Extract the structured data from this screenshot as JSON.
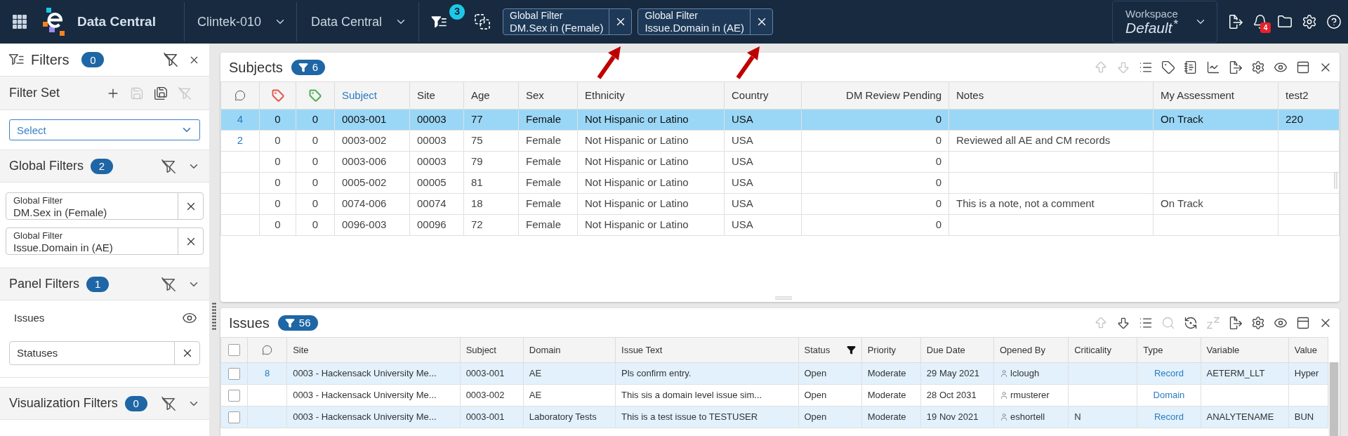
{
  "top_bar": {
    "app_name": "Data Central",
    "study": "Clintek-010",
    "module": "Data Central",
    "active_filter_count": "3",
    "global_filter_chips": [
      {
        "title": "Global Filter",
        "value": "DM.Sex in (Female)"
      },
      {
        "title": "Global Filter",
        "value": "Issue.Domain in (AE)"
      }
    ],
    "workspace": {
      "label": "Workspace",
      "name": "Default",
      "unsaved_mark": "*"
    },
    "notification_count": "4"
  },
  "filters_panel": {
    "title": "Filters",
    "count": "0",
    "filter_set": {
      "title": "Filter Set",
      "actions": [
        {
          "kind": "add",
          "disabled": false
        },
        {
          "kind": "save",
          "disabled": true
        },
        {
          "kind": "save_all",
          "disabled": false
        },
        {
          "kind": "clear",
          "disabled": true
        }
      ],
      "select": {
        "placeholder": "Select"
      }
    },
    "global_filters": {
      "title": "Global Filters",
      "count": "2",
      "filters": [
        {
          "title": "Global Filter",
          "value": "DM.Sex in (Female)"
        },
        {
          "title": "Global Filter",
          "value": "Issue.Domain in (AE)"
        }
      ]
    },
    "panel_filters": {
      "title": "Panel Filters",
      "count": "1",
      "panels": [
        {
          "name": "Issues",
          "filters": [
            {
              "label": "Statuses"
            }
          ]
        }
      ]
    },
    "visualization_filters": {
      "title": "Visualization Filters",
      "count": "0"
    }
  },
  "subjects_panel": {
    "title": "Subjects",
    "filtered_count": "6",
    "toolbar": [
      {
        "kind": "move_up",
        "disabled": true
      },
      {
        "kind": "move_down",
        "disabled": true
      },
      {
        "kind": "list",
        "disabled": false
      },
      {
        "kind": "tag",
        "disabled": false
      },
      {
        "kind": "notebook",
        "disabled": false
      },
      {
        "kind": "chart",
        "disabled": false
      },
      {
        "kind": "export",
        "disabled": false
      },
      {
        "kind": "settings",
        "disabled": false
      },
      {
        "kind": "view",
        "disabled": false
      },
      {
        "kind": "window",
        "disabled": false
      },
      {
        "kind": "close",
        "disabled": false
      }
    ],
    "columns": [
      {
        "kind": "comments"
      },
      {
        "kind": "tag",
        "color": "#e5534b"
      },
      {
        "kind": "tag",
        "color": "#4caf50"
      },
      {
        "kind": "text",
        "label": "Subject",
        "sorted": true
      },
      {
        "kind": "text",
        "label": "Site",
        "sorted": false
      },
      {
        "kind": "text",
        "label": "Age",
        "sorted": false
      },
      {
        "kind": "text",
        "label": "Sex",
        "sorted": false
      },
      {
        "kind": "text",
        "label": "Ethnicity",
        "sorted": false
      },
      {
        "kind": "text",
        "label": "Country",
        "sorted": false
      },
      {
        "kind": "number",
        "label": "DM Review Pending",
        "sorted": false
      },
      {
        "kind": "text",
        "label": "Notes",
        "sorted": false
      },
      {
        "kind": "text",
        "label": "My Assessment",
        "sorted": false
      },
      {
        "kind": "text",
        "label": "test2",
        "sorted": false
      }
    ],
    "rows": [
      {
        "selected": true,
        "cells": [
          "4",
          "0",
          "0",
          "0003-001",
          "00003",
          "77",
          "Female",
          "Not Hispanic or Latino",
          "USA",
          "0",
          null,
          "On Track",
          "220"
        ]
      },
      {
        "selected": false,
        "cells": [
          "2",
          "0",
          "0",
          "0003-002",
          "00003",
          "75",
          "Female",
          "Not Hispanic or Latino",
          "USA",
          "0",
          "Reviewed all AE and CM records",
          null,
          null
        ]
      },
      {
        "selected": false,
        "cells": [
          null,
          "0",
          "0",
          "0003-006",
          "00003",
          "79",
          "Female",
          "Not Hispanic or Latino",
          "USA",
          "0",
          null,
          null,
          null
        ]
      },
      {
        "selected": false,
        "cells": [
          null,
          "0",
          "0",
          "0005-002",
          "00005",
          "81",
          "Female",
          "Not Hispanic or Latino",
          "USA",
          "0",
          null,
          null,
          null
        ]
      },
      {
        "selected": false,
        "cells": [
          null,
          "0",
          "0",
          "0074-006",
          "00074",
          "18",
          "Female",
          "Not Hispanic or Latino",
          "USA",
          "0",
          "This is a note, not a comment",
          "On Track",
          null
        ]
      },
      {
        "selected": false,
        "cells": [
          null,
          "0",
          "0",
          "0096-003",
          "00096",
          "72",
          "Female",
          "Not Hispanic or Latino",
          "USA",
          "0",
          null,
          null,
          null
        ]
      }
    ]
  },
  "issues_panel": {
    "title": "Issues",
    "filtered_count": "56",
    "toolbar": [
      {
        "kind": "move_up",
        "disabled": true
      },
      {
        "kind": "move_down",
        "disabled": false
      },
      {
        "kind": "list",
        "disabled": false
      },
      {
        "kind": "search",
        "disabled": true
      },
      {
        "kind": "cycle",
        "disabled": false
      },
      {
        "kind": "snooze",
        "disabled": true
      },
      {
        "kind": "export",
        "disabled": false
      },
      {
        "kind": "settings",
        "disabled": false
      },
      {
        "kind": "view",
        "disabled": false
      },
      {
        "kind": "window",
        "disabled": false
      },
      {
        "kind": "close",
        "disabled": false
      }
    ],
    "header_checkbox": {
      "checked": false
    },
    "columns": [
      {
        "kind": "comments"
      },
      {
        "kind": "text",
        "label": "Site",
        "filtered": false
      },
      {
        "kind": "text",
        "label": "Subject",
        "filtered": false
      },
      {
        "kind": "text",
        "label": "Domain",
        "filtered": false
      },
      {
        "kind": "text",
        "label": "Issue Text",
        "filtered": false
      },
      {
        "kind": "text",
        "label": "Status",
        "filtered": true
      },
      {
        "kind": "text",
        "label": "Priority",
        "filtered": false
      },
      {
        "kind": "text",
        "label": "Due Date",
        "filtered": false
      },
      {
        "kind": "user",
        "label": "Opened By",
        "filtered": false
      },
      {
        "kind": "text",
        "label": "Criticality",
        "filtered": false
      },
      {
        "kind": "link",
        "label": "Type",
        "filtered": false
      },
      {
        "kind": "text",
        "label": "Variable",
        "filtered": false
      },
      {
        "kind": "text",
        "label": "Value",
        "filtered": false
      }
    ],
    "rows": [
      {
        "highlighted": true,
        "checked": false,
        "cells": [
          "8",
          "0003 - Hackensack University Me...",
          "0003-001",
          "AE",
          "Pls confirm entry.",
          "Open",
          "Moderate",
          "29 May 2021",
          "lclough",
          null,
          "Record",
          "AETERM_LLT",
          "Hyper"
        ]
      },
      {
        "highlighted": false,
        "checked": false,
        "cells": [
          null,
          "0003 - Hackensack University Me...",
          "0003-002",
          "AE",
          "This sis a domain level issue sim...",
          "Open",
          "Moderate",
          "28 Oct 2031",
          "rmusterer",
          null,
          "Domain",
          null,
          null
        ]
      },
      {
        "highlighted": true,
        "checked": false,
        "cells": [
          null,
          "0003 - Hackensack University Me...",
          "0003-001",
          "Laboratory Tests",
          "This is a test issue to TESTUSER",
          "Open",
          "Moderate",
          "19 Nov 2021",
          "eshortell",
          "N",
          "Record",
          "ANALYTENAME",
          "BUN"
        ]
      }
    ]
  }
}
